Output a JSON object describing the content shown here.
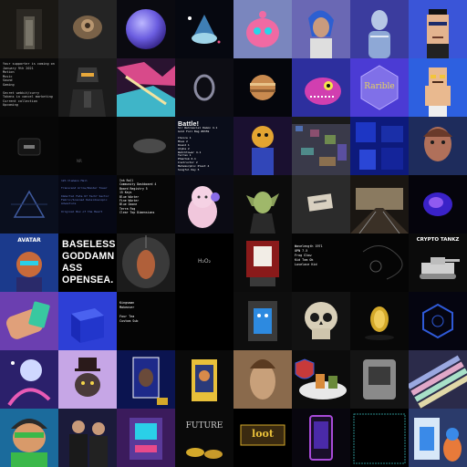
{
  "tiles": {
    "c0": "Your supporter is coming on January 9th 2021\nMotion\nMusic\nSound\nGaming\n\nSecret webkit/curry\nTokens in cancel marketing\nCurrent collection\nUpcoming",
    "battle_title": "Battle!",
    "battle_body": "Sir Wehraaciel Damon 4.1\nGold Foil Bag #0359\n\nChoice 1\nMove 2\nRound 1\nAlpha 2\nWatchtower 4.1\nTerran 1\nPhantom 6.1\nInstructor 2\nMetamorphic Plant 4\nSongful Key 5",
    "list1_a": "Ink Roll\nCommunity Dashboard 4\nBoard Registry 5\n15 Keys\nBlue Winter\nFine Winter\nBlue Ozone\nTerra Fog\nClear Top Dimensions",
    "list1_b": "12h Clemens Mail\n\nTranscend Arrow/Wonder Tower\n\nImmortal Fate 67 Tech? Sector Fabric/Scanned Kaleidoscopic Adventure\n\nOriginal Box of the Heart",
    "baseless": "BASELESS\nGODDAMN\nASS\nOPENSEA.",
    "h2o2": "H₂O₂",
    "list2": "Wavelength 1971\nOPN 7.5\nFrog Glow\nKid Tom Ok\nLovelace Kid",
    "list3": "Kingsman\nMakeover\n\nFour Tea\nCustom Sub",
    "crypto_tankz": "CRYPTO\nTANKZ",
    "avatar": "AVATAR",
    "rarible": "Rarible",
    "future": "FUTURE",
    "loot": "loot"
  },
  "colors": {
    "purple": "#6b3fb0",
    "blue": "#2d3fd6",
    "gold": "#d4a92a"
  }
}
